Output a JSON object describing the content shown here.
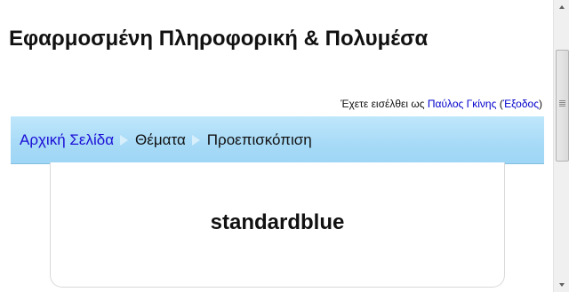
{
  "header": {
    "site_title": "Εφαρμοσμένη Πληροφορική & Πολυμέσα"
  },
  "login": {
    "prefix": "Έχετε εισέλθει ως ",
    "user_name": "Παύλος Γκίνης",
    "logout_open": " (",
    "logout_label": "Έξοδος",
    "logout_close": ")"
  },
  "breadcrumb": {
    "home": "Αρχική Σελίδα",
    "themes": "Θέματα",
    "current": "Προεπισκόπιση"
  },
  "preview": {
    "theme_name": "standardblue"
  },
  "colors": {
    "navbar": "#a6daf7",
    "link": "#1a0dd6"
  },
  "icons": {
    "scroll_up": "arrow-up-icon",
    "scroll_down": "arrow-down-icon",
    "separator": "triangle-right-icon"
  }
}
